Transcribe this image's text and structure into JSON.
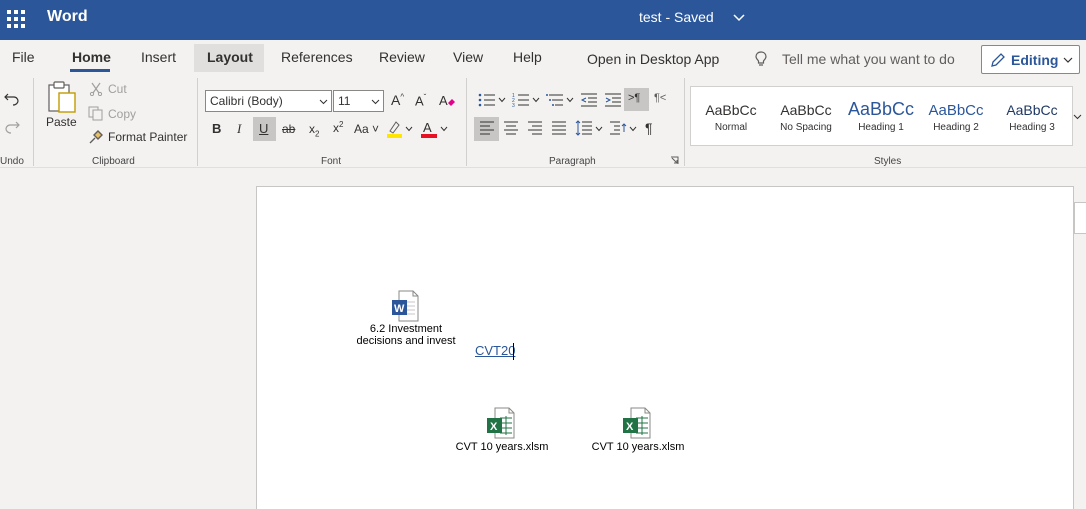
{
  "titlebar": {
    "app_name": "Word",
    "doc_title": "test - Saved"
  },
  "menu": {
    "tabs": [
      "File",
      "Home",
      "Insert",
      "Layout",
      "References",
      "Review",
      "View",
      "Help",
      "Open in Desktop App"
    ],
    "active_tab": "Home",
    "tell_me": "Tell me what you want to do",
    "editing": "Editing"
  },
  "ribbon": {
    "undo_label": "Undo",
    "clipboard": {
      "paste": "Paste",
      "cut": "Cut",
      "copy": "Copy",
      "format_painter": "Format Painter",
      "label": "Clipboard"
    },
    "font": {
      "name": "Calibri (Body)",
      "size": "11",
      "label": "Font",
      "change_case": "Aa"
    },
    "paragraph": {
      "label": "Paragraph"
    },
    "styles": {
      "label": "Styles",
      "items": [
        {
          "sample": "AaBbCc",
          "name": "Normal"
        },
        {
          "sample": "AaBbCc",
          "name": "No Spacing"
        },
        {
          "sample": "AaBbCc",
          "name": "Heading 1"
        },
        {
          "sample": "AaBbCc",
          "name": "Heading 2"
        },
        {
          "sample": "AaBbCc",
          "name": "Heading 3"
        }
      ]
    }
  },
  "document": {
    "embedded_word": {
      "label_line1": "6.2 Investment",
      "label_line2": "decisions and invest"
    },
    "link_text": "CVT20",
    "excel_files": [
      {
        "label": "CVT 10 years.xlsm"
      },
      {
        "label": "CVT 10 years.xlsm"
      }
    ]
  },
  "colors": {
    "brand": "#2b579a",
    "highlight": "#ffe600",
    "font_color": "#e81123",
    "excel": "#217346"
  }
}
